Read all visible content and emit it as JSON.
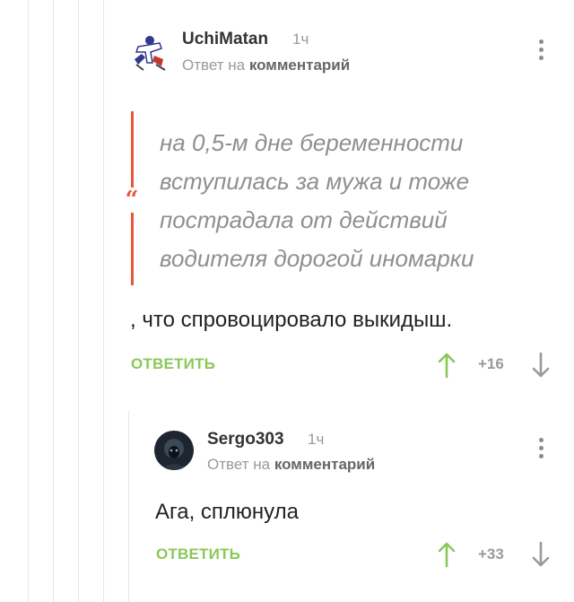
{
  "colors": {
    "accent_green": "#8ac858",
    "quote_red": "#e8573b",
    "muted_gray": "#9a9a9a",
    "thread_line": "#e6e6e6"
  },
  "comments": [
    {
      "author": "UchiMatan",
      "time": "1ч",
      "reply_prefix": "Ответ на",
      "reply_target": "комментарий",
      "quote_mark": "“",
      "quote": "на 0,5-м дне беременности вступилась за мужа и тоже пострадала от действий водителя дорогой иномарки",
      "text": ", что спровоцировало выкидыш.",
      "reply_label": "ОТВЕТИТЬ",
      "score": "+16",
      "icons": {
        "menu": "more-vertical-icon",
        "up": "arrow-up-icon",
        "down": "arrow-down-icon"
      }
    },
    {
      "author": "Sergo303",
      "time": "1ч",
      "reply_prefix": "Ответ на",
      "reply_target": "комментарий",
      "text": "Ага, сплюнула",
      "reply_label": "ОТВЕТИТЬ",
      "score": "+33",
      "icons": {
        "menu": "more-vertical-icon",
        "up": "arrow-up-icon",
        "down": "arrow-down-icon"
      }
    }
  ]
}
